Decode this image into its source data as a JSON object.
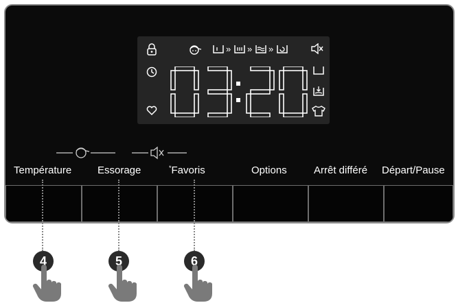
{
  "display": {
    "time_digits": [
      "0",
      "3",
      "2",
      "0"
    ],
    "time_separator": ":",
    "left_icons": [
      "lock-icon",
      "clock-icon",
      "heart-icon"
    ],
    "top_icons": [
      "kid-icon",
      "prewash-tub-icon",
      "wash-tub-icon",
      "rinse-tub-icon",
      "spin-tub-icon",
      "mute-icon"
    ],
    "right_icons": [
      "drain-tub-icon",
      "add-load-icon",
      "shirt-icon"
    ],
    "chevron_symbol": "»"
  },
  "indicators": [
    "kid-lock-indicator",
    "mute-indicator"
  ],
  "buttons": [
    {
      "label": "Température",
      "name": "temperature"
    },
    {
      "label": "Essorage",
      "name": "spin"
    },
    {
      "label": "Favoris",
      "name": "favorites",
      "mark": "*"
    },
    {
      "label": "Options",
      "name": "options"
    },
    {
      "label": "Arrêt différé",
      "name": "delay-end"
    },
    {
      "label": "Départ/Pause",
      "name": "start-pause"
    }
  ],
  "callouts": [
    "4",
    "5",
    "6"
  ],
  "colors": {
    "panel": "#0b0b0b",
    "display": "#252525",
    "segment": "#ffffff",
    "callout": "#2a2a2a",
    "hand": "#7a7a7a"
  }
}
